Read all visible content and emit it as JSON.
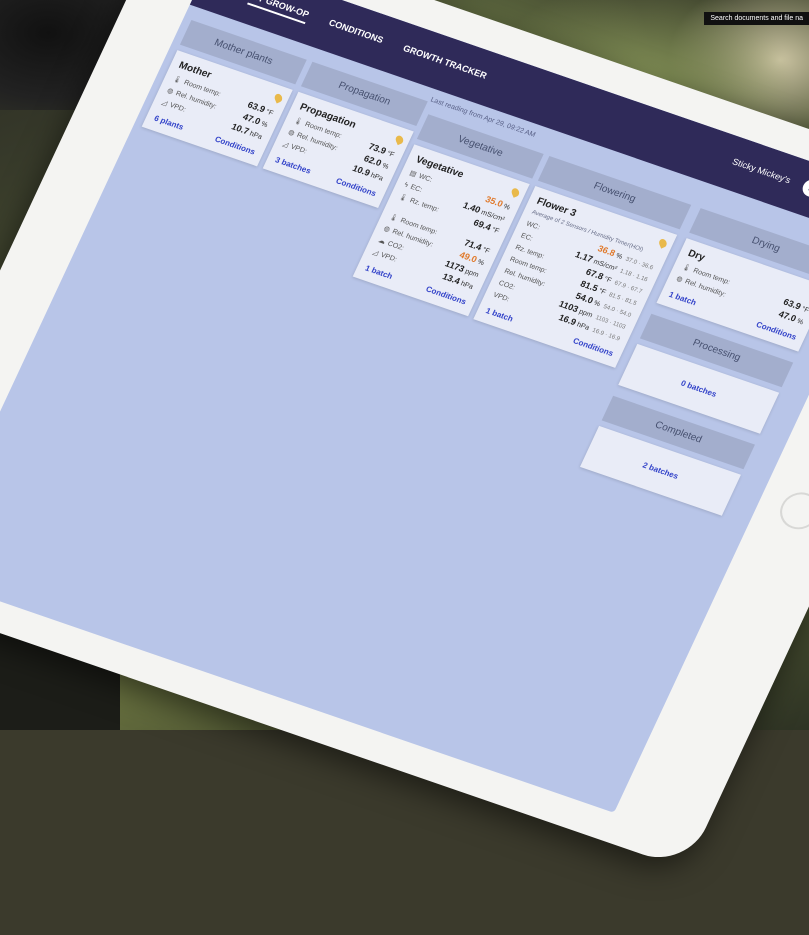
{
  "tooltip": "Search documents and file na",
  "nav": {
    "items": [
      "MY GROW-OP",
      "CONDITIONS",
      "GROWTH TRACKER"
    ],
    "account": "Sticky Mickey's"
  },
  "last_reading": "Last reading from Apr 29, 09:22 AM",
  "stages": {
    "mother": {
      "head": "Mother plants",
      "title": "Mother",
      "labels": [
        "Room temp:",
        "Rel. humidity:",
        "VPD:"
      ],
      "values": [
        "63.9",
        "47.0",
        "10.7"
      ],
      "units": [
        "°F",
        "%",
        "hPa"
      ],
      "link": "6 plants",
      "conditions": "Conditions"
    },
    "propagation": {
      "head": "Propagation",
      "title": "Propagation",
      "labels": [
        "Room temp:",
        "Rel. humidity:",
        "VPD:"
      ],
      "values": [
        "73.9",
        "62.0",
        "10.9"
      ],
      "units": [
        "°F",
        "%",
        "hPa"
      ],
      "link": "3 batches",
      "conditions": "Conditions"
    },
    "vegetative": {
      "head": "Vegetative",
      "title": "Vegetative",
      "labels_a": [
        "WC:",
        "EC:",
        "Rz. temp:"
      ],
      "values_a": [
        "35.0",
        "1.40",
        "69.4"
      ],
      "units_a": [
        "%",
        "mS/cm²",
        "°F"
      ],
      "labels_b": [
        "Room temp:",
        "Rel. humidity:",
        "CO2:",
        "VPD:"
      ],
      "values_b": [
        "71.4",
        "49.0",
        "1173",
        "13.4"
      ],
      "units_b": [
        "°F",
        "%",
        "ppm",
        "hPa"
      ],
      "link": "1 batch",
      "conditions": "Conditions"
    },
    "flowering": {
      "head": "Flowering",
      "title": "Flower 3",
      "subtitle": "Average of 2 Sensors / Humidity Timer(HOI)",
      "labels": [
        "WC:",
        "EC:",
        "Rz. temp:",
        "Room temp:",
        "Rel. humidity:",
        "CO2:",
        "VPD:"
      ],
      "values": [
        "36.8",
        "1.17",
        "67.8",
        "81.5",
        "54.0",
        "1103",
        "16.9"
      ],
      "units": [
        "%",
        "mS/cm²",
        "°F",
        "°F",
        "%",
        "ppm",
        "hPa"
      ],
      "ranges": [
        "37.0 · 36.6",
        "1.18 · 1.16",
        "67.9 · 67.7",
        "81.5 · 81.5",
        "54.0 · 54.0",
        "1103 · 1103",
        "16.9 · 16.9"
      ],
      "link": "1 batch",
      "conditions": "Conditions"
    },
    "drying": {
      "head": "Drying",
      "title": "Dry",
      "labels": [
        "Room temp:",
        "Rel. humidity:"
      ],
      "values": [
        "63.9",
        "47.0"
      ],
      "units": [
        "°F",
        "%"
      ],
      "link": "1 batch",
      "conditions": "Conditions"
    },
    "processing": {
      "head": "Processing",
      "link": "0 batches"
    },
    "completed": {
      "head": "Completed",
      "link": "2 batches"
    }
  }
}
